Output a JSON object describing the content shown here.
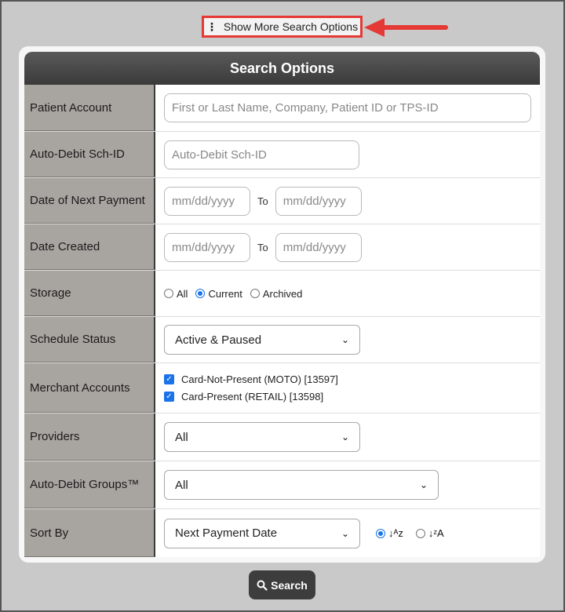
{
  "top_link": {
    "label": "Show More Search Options"
  },
  "panel": {
    "title": "Search Options"
  },
  "rows": {
    "patient_account": {
      "label": "Patient Account",
      "placeholder": "First or Last Name, Company, Patient ID or TPS-ID"
    },
    "auto_debit_sch_id": {
      "label": "Auto-Debit Sch-ID",
      "placeholder": "Auto-Debit Sch-ID"
    },
    "date_next_payment": {
      "label": "Date of Next Payment",
      "from_placeholder": "mm/dd/yyyy",
      "to_label": "To",
      "to_placeholder": "mm/dd/yyyy"
    },
    "date_created": {
      "label": "Date Created",
      "from_placeholder": "mm/dd/yyyy",
      "to_label": "To",
      "to_placeholder": "mm/dd/yyyy"
    },
    "storage": {
      "label": "Storage",
      "options": [
        "All",
        "Current",
        "Archived"
      ],
      "selected": "Current"
    },
    "schedule_status": {
      "label": "Schedule Status",
      "value": "Active & Paused"
    },
    "merchant_accounts": {
      "label": "Merchant Accounts",
      "items": [
        "Card-Not-Present (MOTO) [13597]",
        "Card-Present (RETAIL) [13598]"
      ]
    },
    "providers": {
      "label": "Providers",
      "value": "All"
    },
    "auto_debit_groups": {
      "label": "Auto-Debit Groups™",
      "value": "All"
    },
    "sort_by": {
      "label": "Sort By",
      "value": "Next Payment Date",
      "order_options": [
        "ascending",
        "descending"
      ],
      "order_selected": "ascending"
    }
  },
  "search_button": {
    "label": "Search"
  },
  "colors": {
    "accent_blue": "#1a73e8",
    "highlight_red": "#e53935",
    "header_dark": "#3a3a3a",
    "label_bg": "#a8a4a0"
  }
}
